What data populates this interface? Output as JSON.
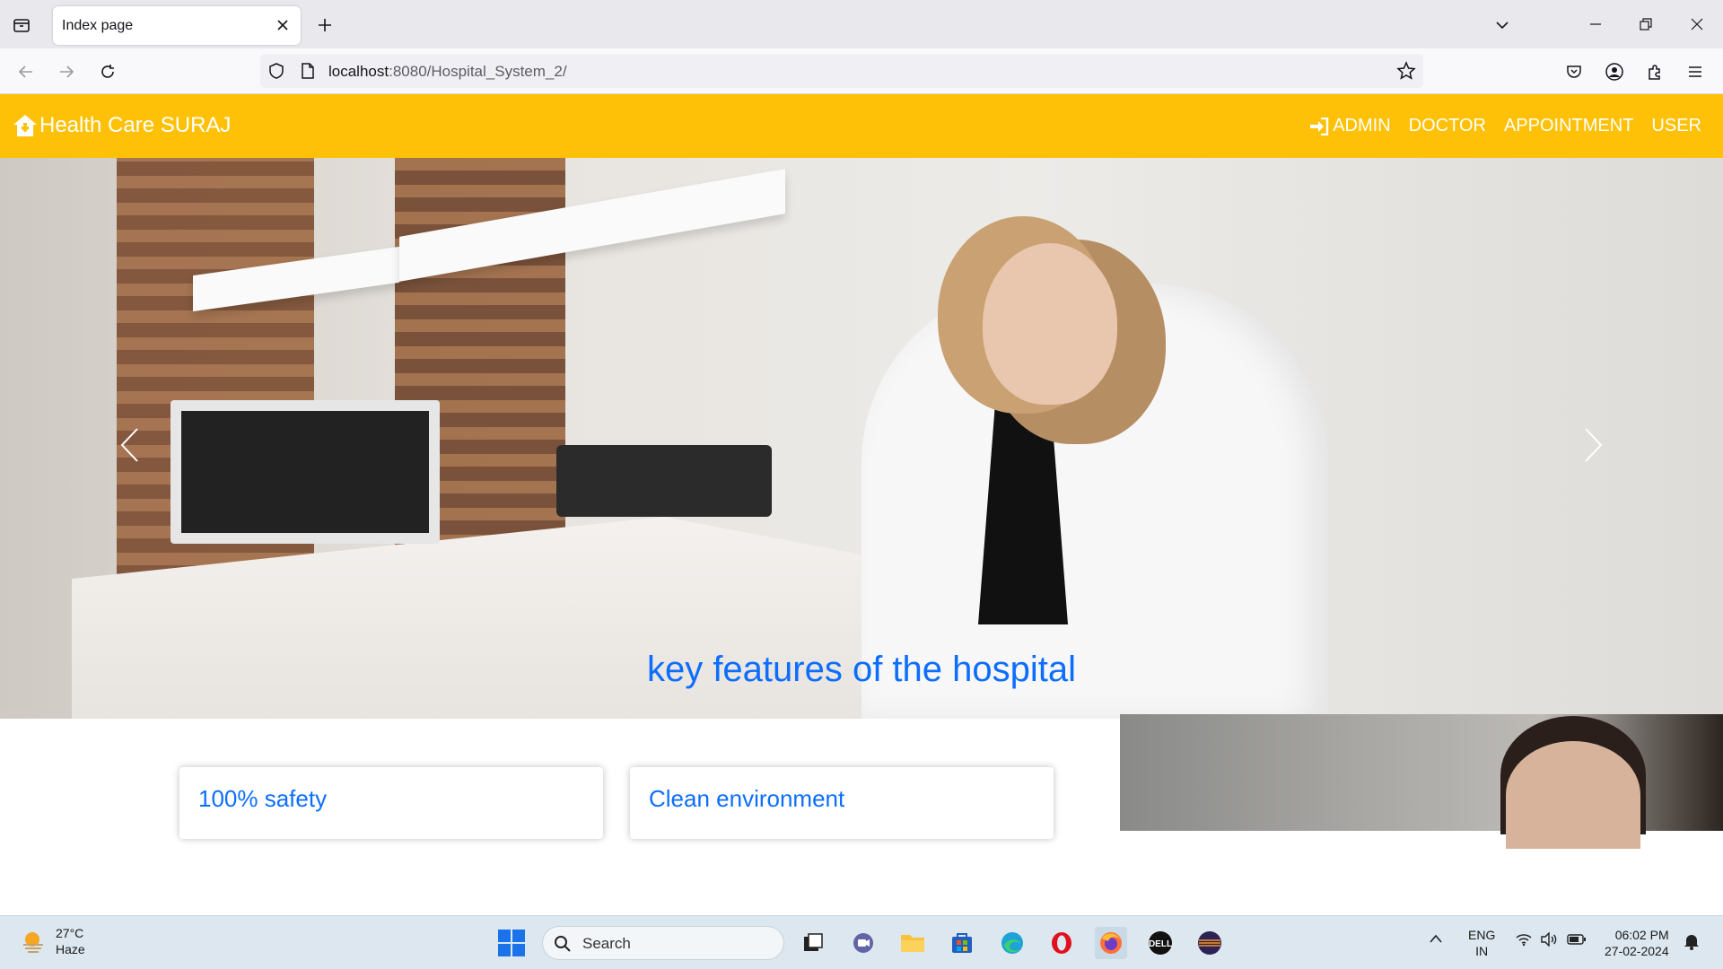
{
  "browser": {
    "tab_title": "Index page",
    "url_host": "localhost",
    "url_rest": ":8080/Hospital_System_2/"
  },
  "site": {
    "brand": "Health Care SURAJ",
    "menu": [
      "ADMIN",
      "DOCTOR",
      "APPOINTMENT",
      "USER"
    ],
    "section_title": "key features of the hospital",
    "cards": [
      "100% safety",
      "Clean environment"
    ]
  },
  "taskbar": {
    "temperature": "27°C",
    "weather": "Haze",
    "search_placeholder": "Search",
    "lang_top": "ENG",
    "lang_bottom": "IN",
    "time": "06:02 PM",
    "date": "27-02-2024"
  },
  "colors": {
    "nav_bg": "#ffc107",
    "accent_blue": "#0d6efd"
  }
}
